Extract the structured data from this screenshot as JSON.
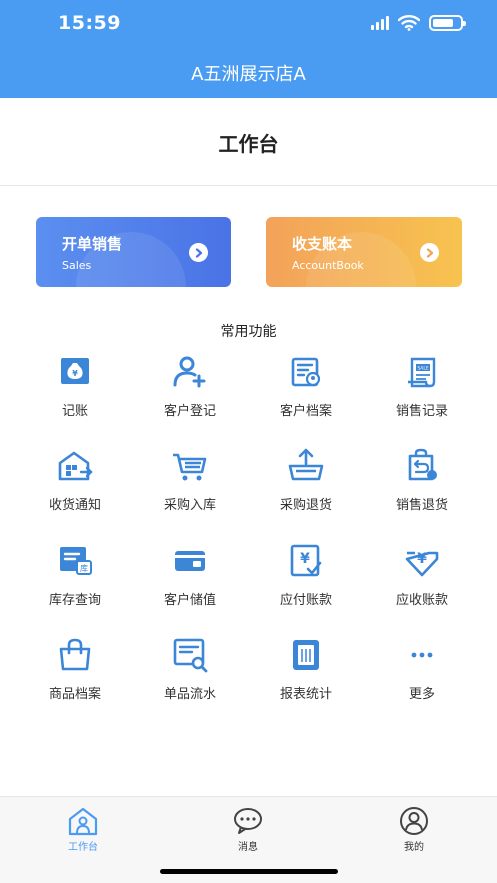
{
  "status": {
    "time": "15:59"
  },
  "header": {
    "store_name": "A五洲展示店A"
  },
  "page": {
    "title": "工作台"
  },
  "cards": [
    {
      "title": "开单销售",
      "subtitle": "Sales",
      "color": "#4a73e6"
    },
    {
      "title": "收支账本",
      "subtitle": "AccountBook",
      "color": "#f5b251"
    }
  ],
  "section": {
    "title": "常用功能"
  },
  "functions": [
    {
      "label": "记账",
      "icon": "money-bag-icon"
    },
    {
      "label": "客户登记",
      "icon": "add-user-icon"
    },
    {
      "label": "客户档案",
      "icon": "customer-file-icon"
    },
    {
      "label": "销售记录",
      "icon": "sales-scroll-icon"
    },
    {
      "label": "收货通知",
      "icon": "warehouse-icon"
    },
    {
      "label": "采购入库",
      "icon": "shopping-cart-icon"
    },
    {
      "label": "采购退货",
      "icon": "return-basket-icon"
    },
    {
      "label": "销售退货",
      "icon": "return-bag-icon"
    },
    {
      "label": "库存查询",
      "icon": "inventory-doc-icon"
    },
    {
      "label": "客户储值",
      "icon": "stored-value-card-icon"
    },
    {
      "label": "应付账款",
      "icon": "payable-doc-icon"
    },
    {
      "label": "应收账款",
      "icon": "receivable-icon"
    },
    {
      "label": "商品档案",
      "icon": "shopping-bag-icon"
    },
    {
      "label": "单品流水",
      "icon": "search-doc-icon"
    },
    {
      "label": "报表统计",
      "icon": "report-book-icon"
    },
    {
      "label": "更多",
      "icon": "more-dots-icon"
    }
  ],
  "tabs": [
    {
      "label": "工作台",
      "icon": "home-person-icon",
      "active": true
    },
    {
      "label": "消息",
      "icon": "chat-bubble-icon",
      "active": false
    },
    {
      "label": "我的",
      "icon": "profile-icon",
      "active": false
    }
  ],
  "colors": {
    "primary": "#4a9cf2",
    "icon_blue": "#3b86d6",
    "sales_card": "#4a73e6",
    "book_card": "#f5b251"
  }
}
